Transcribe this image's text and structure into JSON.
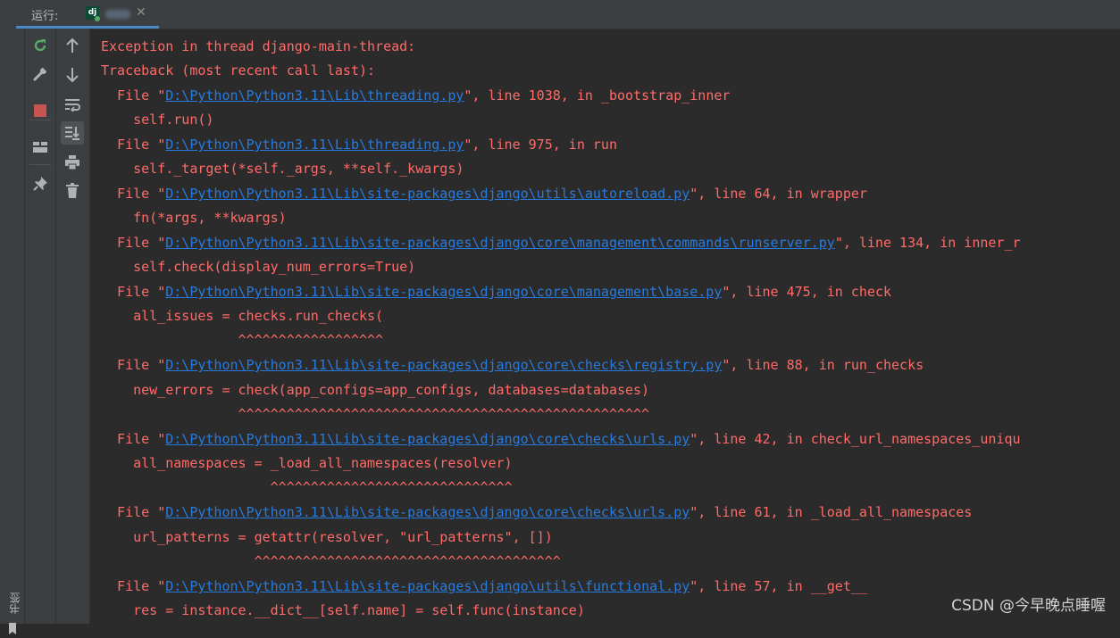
{
  "topbar": {
    "run_label": "运行:",
    "tab_icon": "dj",
    "close_glyph": "✕"
  },
  "left_strip": {
    "bookmarks_label": "书签"
  },
  "toolbar1": [
    "rerun-icon",
    "wrench-icon",
    "stop-icon",
    "layout-icon",
    "pin-icon"
  ],
  "toolbar2": [
    "up-arrow-icon",
    "down-arrow-icon",
    "soft-wrap-icon",
    "scroll-to-end-icon",
    "print-icon",
    "trash-icon"
  ],
  "colors": {
    "error_text": "#ff6b68",
    "link": "#287bde",
    "background": "#2b2b2b",
    "toolbar": "#3c3f41",
    "rerun_green": "#59a869",
    "stop_red": "#c75450"
  },
  "console": {
    "lines": [
      {
        "pre": "Exception in thread django-main-thread:",
        "link": "",
        "post": ""
      },
      {
        "pre": "Traceback (most recent call last):",
        "link": "",
        "post": ""
      },
      {
        "pre": "  File \"",
        "link": "D:\\Python\\Python3.11\\Lib\\threading.py",
        "post": "\", line 1038, in _bootstrap_inner"
      },
      {
        "pre": "    self.run()",
        "link": "",
        "post": ""
      },
      {
        "pre": "  File \"",
        "link": "D:\\Python\\Python3.11\\Lib\\threading.py",
        "post": "\", line 975, in run"
      },
      {
        "pre": "    self._target(*self._args, **self._kwargs)",
        "link": "",
        "post": ""
      },
      {
        "pre": "  File \"",
        "link": "D:\\Python\\Python3.11\\Lib\\site-packages\\django\\utils\\autoreload.py",
        "post": "\", line 64, in wrapper"
      },
      {
        "pre": "    fn(*args, **kwargs)",
        "link": "",
        "post": ""
      },
      {
        "pre": "  File \"",
        "link": "D:\\Python\\Python3.11\\Lib\\site-packages\\django\\core\\management\\commands\\runserver.py",
        "post": "\", line 134, in inner_r"
      },
      {
        "pre": "    self.check(display_num_errors=True)",
        "link": "",
        "post": ""
      },
      {
        "pre": "  File \"",
        "link": "D:\\Python\\Python3.11\\Lib\\site-packages\\django\\core\\management\\base.py",
        "post": "\", line 475, in check"
      },
      {
        "pre": "    all_issues = checks.run_checks(",
        "link": "",
        "post": ""
      },
      {
        "pre": "                 ^^^^^^^^^^^^^^^^^^",
        "link": "",
        "post": ""
      },
      {
        "pre": "  File \"",
        "link": "D:\\Python\\Python3.11\\Lib\\site-packages\\django\\core\\checks\\registry.py",
        "post": "\", line 88, in run_checks"
      },
      {
        "pre": "    new_errors = check(app_configs=app_configs, databases=databases)",
        "link": "",
        "post": ""
      },
      {
        "pre": "                 ^^^^^^^^^^^^^^^^^^^^^^^^^^^^^^^^^^^^^^^^^^^^^^^^^^^",
        "link": "",
        "post": ""
      },
      {
        "pre": "  File \"",
        "link": "D:\\Python\\Python3.11\\Lib\\site-packages\\django\\core\\checks\\urls.py",
        "post": "\", line 42, in check_url_namespaces_uniqu"
      },
      {
        "pre": "    all_namespaces = _load_all_namespaces(resolver)",
        "link": "",
        "post": ""
      },
      {
        "pre": "                     ^^^^^^^^^^^^^^^^^^^^^^^^^^^^^^",
        "link": "",
        "post": ""
      },
      {
        "pre": "  File \"",
        "link": "D:\\Python\\Python3.11\\Lib\\site-packages\\django\\core\\checks\\urls.py",
        "post": "\", line 61, in _load_all_namespaces"
      },
      {
        "pre": "    url_patterns = getattr(resolver, \"url_patterns\", [])",
        "link": "",
        "post": ""
      },
      {
        "pre": "                   ^^^^^^^^^^^^^^^^^^^^^^^^^^^^^^^^^^^^^^",
        "link": "",
        "post": ""
      },
      {
        "pre": "  File \"",
        "link": "D:\\Python\\Python3.11\\Lib\\site-packages\\django\\utils\\functional.py",
        "post": "\", line 57, in __get__"
      },
      {
        "pre": "    res = instance.__dict__[self.name] = self.func(instance)",
        "link": "",
        "post": ""
      }
    ]
  },
  "watermark": "CSDN @今早晚点睡喔"
}
